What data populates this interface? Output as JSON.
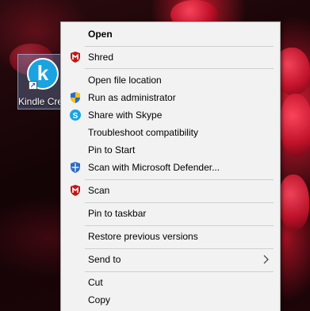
{
  "desktop": {
    "icon_label": "Kindle Create",
    "icon_letter": "k"
  },
  "menu": {
    "open": "Open",
    "shred": "Shred",
    "open_file_location": "Open file location",
    "run_as_admin": "Run as administrator",
    "share_skype": "Share with Skype",
    "troubleshoot": "Troubleshoot compatibility",
    "pin_to_start": "Pin to Start",
    "scan_defender": "Scan with Microsoft Defender...",
    "scan": "Scan",
    "pin_to_taskbar": "Pin to taskbar",
    "restore_versions": "Restore previous versions",
    "send_to": "Send to",
    "cut": "Cut",
    "copy": "Copy"
  },
  "icons": {
    "shred": "mcafee-shield-icon",
    "run_as_admin": "uac-shield-icon",
    "share_skype": "skype-icon",
    "scan_defender": "defender-shield-icon",
    "scan": "mcafee-shield-icon",
    "send_to": "chevron-right-icon"
  },
  "colors": {
    "menu_bg": "#f2f2f2",
    "mcafee_red": "#c01818",
    "skype_blue": "#1aa3e0",
    "defender_blue": "#2b6cc4",
    "app_icon_blue": "#1aa3e0"
  }
}
